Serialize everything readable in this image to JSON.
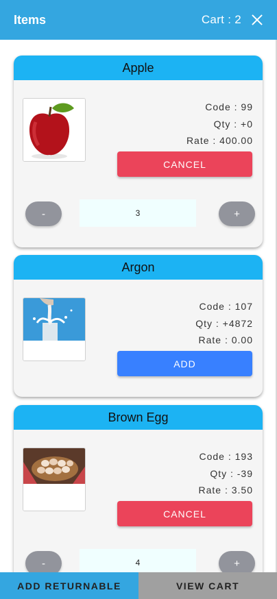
{
  "header": {
    "title": "Items",
    "cart_label": "Cart : 2",
    "close_icon": "close-icon"
  },
  "items": [
    {
      "name": "Apple",
      "image": "apple-image",
      "code": "Code : 99",
      "qty": "Qty : +0",
      "rate": "Rate : 400.00",
      "action": "CANCEL",
      "quantity": "3",
      "minus": "-",
      "plus": "+"
    },
    {
      "name": "Argon",
      "image": "milk-splash-image",
      "code": "Code : 107",
      "qty": "Qty : +4872",
      "rate": "Rate : 0.00",
      "action": "ADD"
    },
    {
      "name": "Brown Egg",
      "image": "egg-basket-image",
      "code": "Code : 193",
      "qty": "Qty : -39",
      "rate": "Rate : 3.50",
      "action": "CANCEL",
      "quantity": "4",
      "minus": "-",
      "plus": "+"
    }
  ],
  "footer": {
    "add_returnable": "ADD RETURNABLE",
    "view_cart": "VIEW CART"
  },
  "colors": {
    "header": "#34a6e0",
    "card_header": "#1cb3f3",
    "cancel": "#eb445a",
    "add": "#3880ff",
    "stepper": "#92949c",
    "view_cart": "#a0a0a0"
  }
}
